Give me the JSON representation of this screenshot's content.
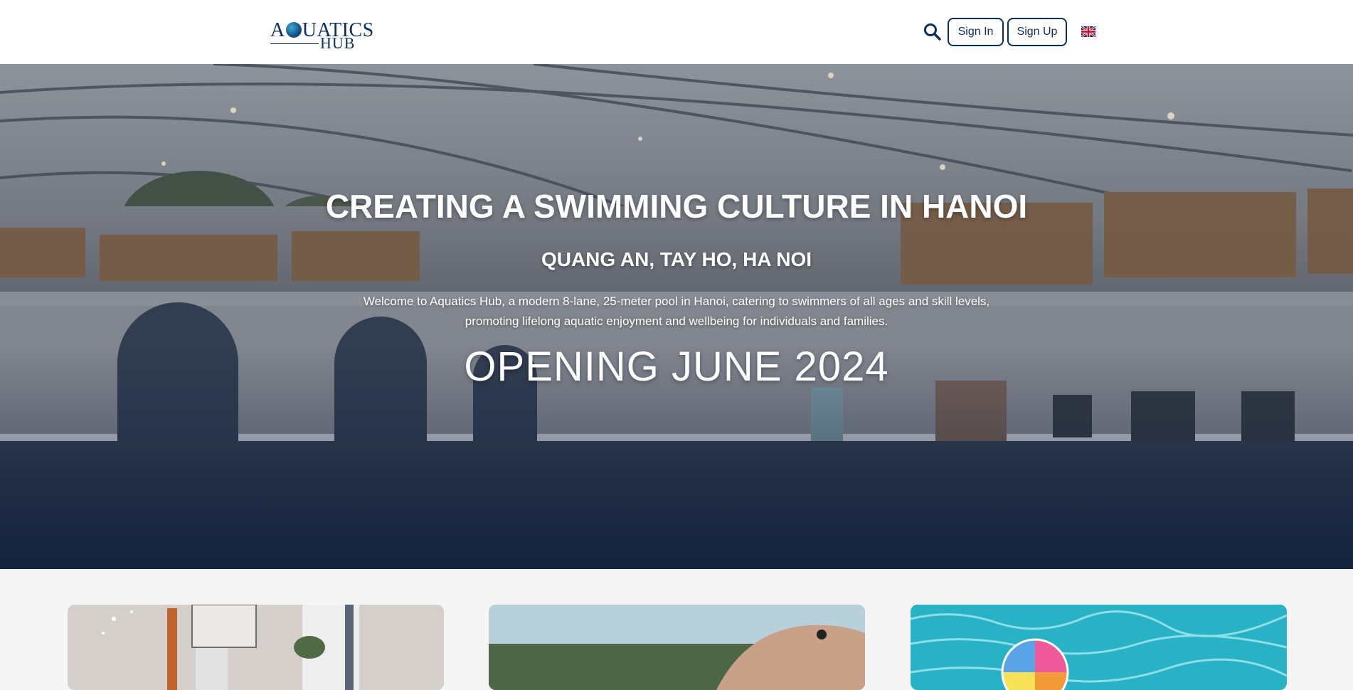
{
  "header": {
    "logo": {
      "line1": "AQUATICS",
      "line2": "HUB"
    },
    "search_icon": "search-icon",
    "signin_label": "Sign In",
    "signup_label": "Sign Up",
    "language_flag": "uk-flag-icon"
  },
  "hero": {
    "title": "CREATING A SWIMMING CULTURE IN HANOI",
    "subtitle": "QUANG AN, TAY HO, HA NOI",
    "description": "Welcome to Aquatics Hub, a modern 8-lane, 25-meter pool in Hanoi, catering to swimmers of all ages and skill levels, promoting lifelong aquatic enjoyment and wellbeing for individuals and families.",
    "opening": "OPENING JUNE 2024"
  },
  "cards": [
    {
      "image": "indoor-swimming-photo"
    },
    {
      "image": "open-water-swimmer-photo"
    },
    {
      "image": "pool-beach-ball-photo"
    }
  ],
  "colors": {
    "brand": "#0c2f5a",
    "header_bg": "#ffffff",
    "hero_text": "#ffffff",
    "page_bg": "#f5f5f5"
  }
}
